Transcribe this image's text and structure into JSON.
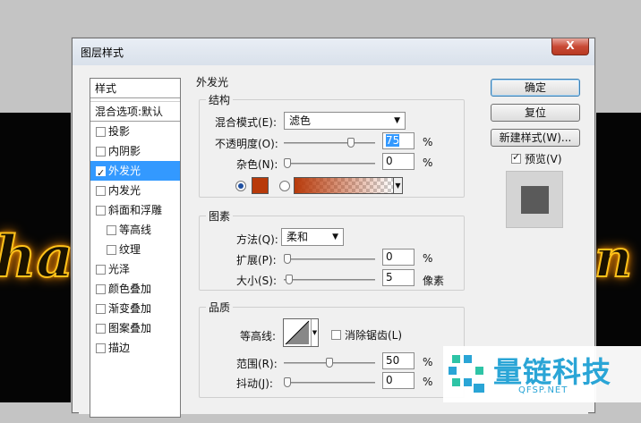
{
  "dialog": {
    "title": "图层样式",
    "close_label": "X"
  },
  "style_list": {
    "header": "样式",
    "blend_options": "混合选项:默认",
    "items": [
      {
        "label": "投影",
        "checked": false,
        "sub": false,
        "active": false
      },
      {
        "label": "内阴影",
        "checked": false,
        "sub": false,
        "active": false
      },
      {
        "label": "外发光",
        "checked": true,
        "sub": false,
        "active": true
      },
      {
        "label": "内发光",
        "checked": false,
        "sub": false,
        "active": false
      },
      {
        "label": "斜面和浮雕",
        "checked": false,
        "sub": false,
        "active": false
      },
      {
        "label": "等高线",
        "checked": false,
        "sub": true,
        "active": false
      },
      {
        "label": "纹理",
        "checked": false,
        "sub": true,
        "active": false
      },
      {
        "label": "光泽",
        "checked": false,
        "sub": false,
        "active": false
      },
      {
        "label": "颜色叠加",
        "checked": false,
        "sub": false,
        "active": false
      },
      {
        "label": "渐变叠加",
        "checked": false,
        "sub": false,
        "active": false
      },
      {
        "label": "图案叠加",
        "checked": false,
        "sub": false,
        "active": false
      },
      {
        "label": "描边",
        "checked": false,
        "sub": false,
        "active": false
      }
    ]
  },
  "panel": {
    "title": "外发光",
    "structure": {
      "legend": "结构",
      "blend_mode_label": "混合模式(E):",
      "blend_mode_value": "滤色",
      "opacity_label": "不透明度(O):",
      "opacity_value": "75",
      "opacity_unit": "%",
      "opacity_level": 0.75,
      "noise_label": "杂色(N):",
      "noise_value": "0",
      "noise_unit": "%",
      "noise_level": 0,
      "glow_color": "#b83a0a"
    },
    "elements": {
      "legend": "图素",
      "method_label": "方法(Q):",
      "method_value": "柔和",
      "spread_label": "扩展(P):",
      "spread_value": "0",
      "spread_unit": "%",
      "spread_level": 0,
      "size_label": "大小(S):",
      "size_value": "5",
      "size_unit": "像素",
      "size_level": 0.02
    },
    "quality": {
      "legend": "品质",
      "contour_label": "等高线:",
      "antialias_label": "消除锯齿(L)",
      "range_label": "范围(R):",
      "range_value": "50",
      "range_unit": "%",
      "range_level": 0.5,
      "jitter_label": "抖动(J):",
      "jitter_value": "0",
      "jitter_unit": "%",
      "jitter_level": 0
    }
  },
  "buttons": {
    "ok": "确定",
    "reset": "复位",
    "new_style": "新建样式(W)...",
    "preview": "预览(V)"
  },
  "background": {
    "glow_left": "ha",
    "glow_right": "n",
    "glow_color": "#ffc21a"
  },
  "watermark": {
    "text": "量链科技",
    "sub": "QFSP.NET"
  }
}
